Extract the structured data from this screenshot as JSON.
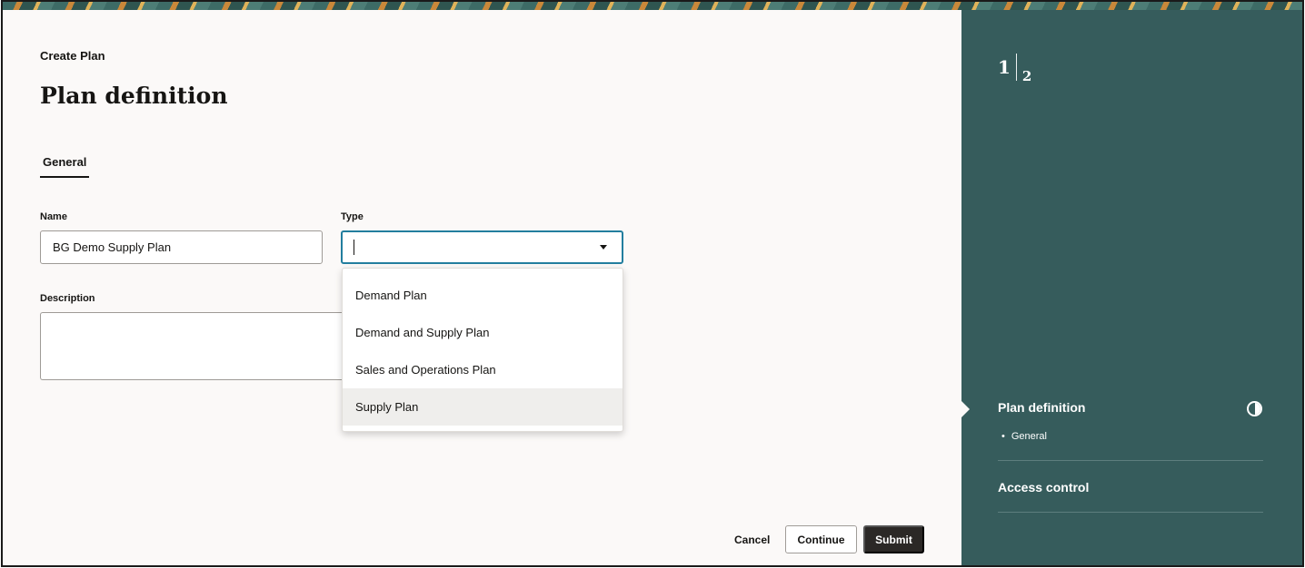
{
  "header": {
    "breadcrumb": "Create Plan",
    "title": "Plan definition"
  },
  "tabs": [
    {
      "label": "General",
      "active": true
    }
  ],
  "form": {
    "name": {
      "label": "Name",
      "value": "BG Demo Supply Plan"
    },
    "type": {
      "label": "Type",
      "value": "",
      "options": [
        "Demand Plan",
        "Demand and Supply Plan",
        "Sales and Operations Plan",
        "Supply Plan"
      ],
      "highlighted": "Supply Plan"
    },
    "description": {
      "label": "Description",
      "value": ""
    }
  },
  "actions": {
    "cancel": "Cancel",
    "continue": "Continue",
    "submit": "Submit"
  },
  "steps": {
    "current": "1",
    "total": "2",
    "items": [
      {
        "label": "Plan definition",
        "substeps": [
          "General"
        ],
        "status_icon": "half-circle-icon"
      },
      {
        "label": "Access control",
        "substeps": []
      }
    ]
  },
  "colors": {
    "side_panel": "#365c5c",
    "focus_border": "#227e9e",
    "submit_bg": "#2b2826"
  }
}
